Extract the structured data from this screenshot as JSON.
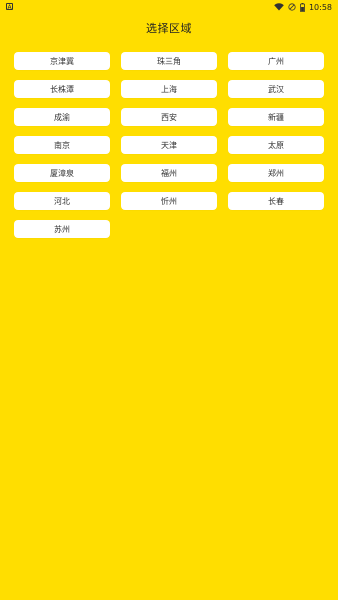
{
  "status_bar": {
    "left_icon": "A",
    "time": "10:58",
    "icons": [
      "wifi-icon",
      "dnd-icon",
      "battery-icon"
    ]
  },
  "header": {
    "title": "选择区域"
  },
  "regions": [
    "京津冀",
    "珠三角",
    "广州",
    "长株潭",
    "上海",
    "武汉",
    "成渝",
    "西安",
    "新疆",
    "南京",
    "天津",
    "太原",
    "厦漳泉",
    "福州",
    "郑州",
    "河北",
    "忻州",
    "长春",
    "苏州"
  ],
  "colors": {
    "background": "#FFDE00",
    "button": "#FFFFFF"
  }
}
